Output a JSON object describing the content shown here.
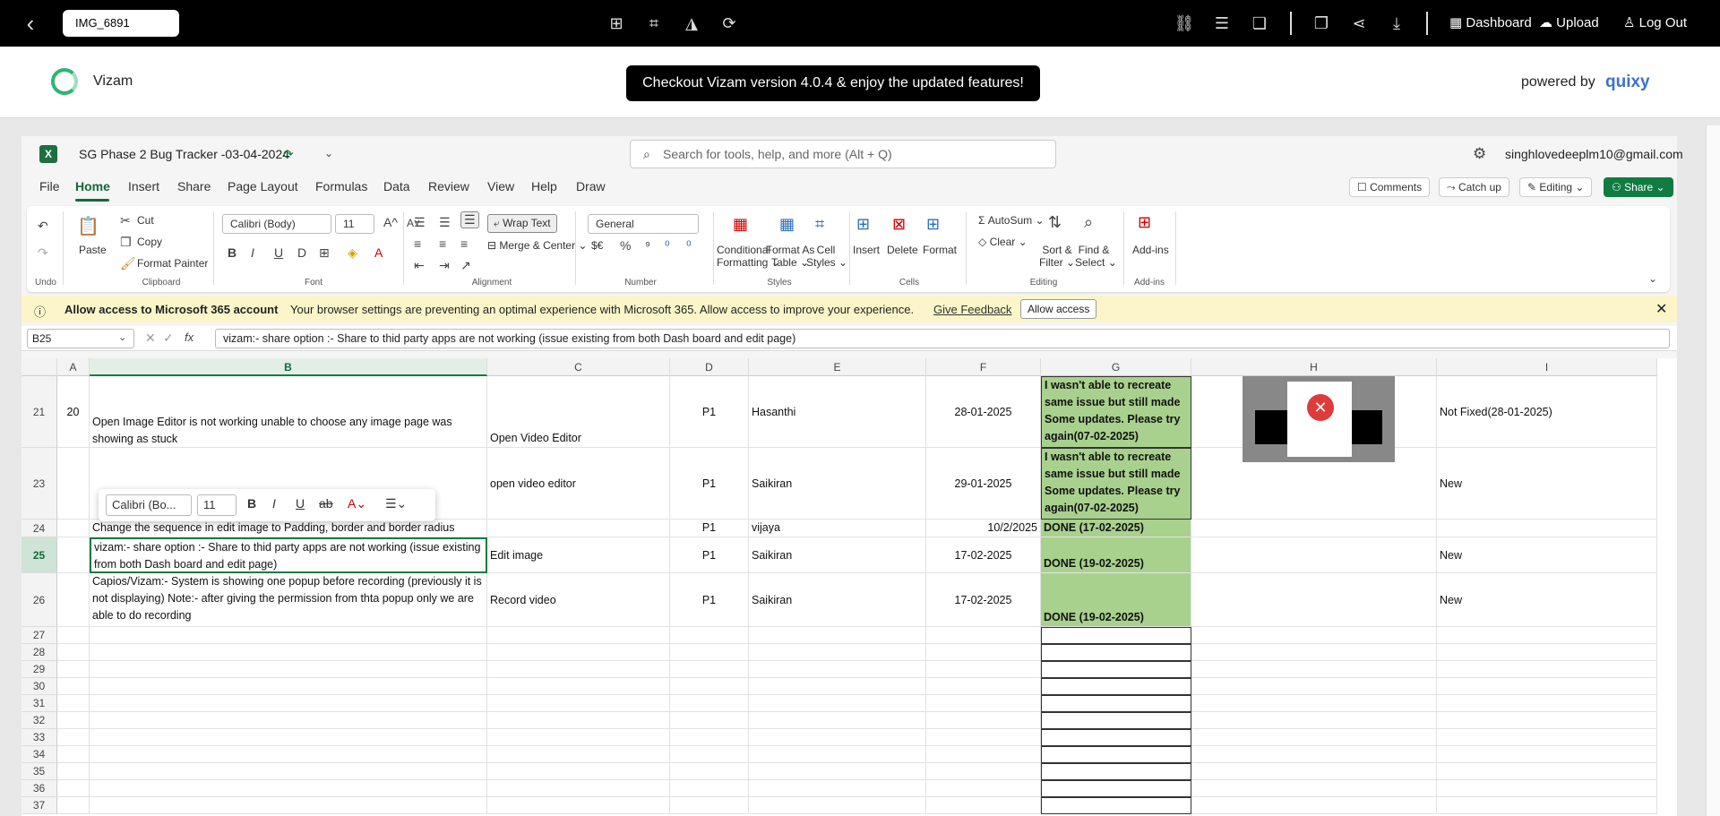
{
  "topbar": {
    "filename": "IMG_6891",
    "dashboard": "Dashboard",
    "upload": "Upload",
    "logout": "Log Out"
  },
  "header": {
    "brand": "Vizam",
    "promo": "Checkout Vizam version 4.0.4 & enjoy the updated features!",
    "powered_by": "powered by",
    "partner": "quixy"
  },
  "excel": {
    "doc_title": "SG Phase 2 Bug Tracker -03-04-2024",
    "search_placeholder": "Search for tools, help, and more (Alt + Q)",
    "account": "singhlovedeeplm10@gmail.com",
    "tabs": [
      "File",
      "Home",
      "Insert",
      "Share",
      "Page Layout",
      "Formulas",
      "Data",
      "Review",
      "View",
      "Help",
      "Draw"
    ],
    "top_buttons": {
      "comments": "Comments",
      "catchup": "Catch up",
      "editing": "Editing",
      "share": "Share"
    },
    "ribbon": {
      "undo_group": "Undo",
      "paste": "Paste",
      "cut": "Cut",
      "copy": "Copy",
      "format_painter": "Format Painter",
      "clipboard_group": "Clipboard",
      "font_name": "Calibri (Body)",
      "font_size": "11",
      "font_group": "Font",
      "wrap_text": "Wrap Text",
      "merge_center": "Merge & Center",
      "alignment_group": "Alignment",
      "number_format": "General",
      "currency": "$€",
      "number_group": "Number",
      "conditional": "Conditional",
      "formatting": "Formatting",
      "format_as": "Format As",
      "table": "Table",
      "cell": "Cell",
      "styles": "Styles",
      "styles_group": "Styles",
      "insert": "Insert",
      "delete": "Delete",
      "format": "Format",
      "cells_group": "Cells",
      "autosum": "AutoSum",
      "clear": "Clear",
      "sort": "Sort &",
      "filter": "Filter",
      "find": "Find &",
      "select": "Select",
      "editing_group": "Editing",
      "addins": "Add-ins",
      "addins_group": "Add-ins"
    },
    "infobar": {
      "title": "Allow access to Microsoft 365 account",
      "message": "Your browser settings are preventing an optimal experience with Microsoft 365. Allow access to improve your experience.",
      "feedback": "Give Feedback",
      "allow": "Allow access"
    },
    "namebox": "B25",
    "formula": "vizam:- share option :- Share to thid party apps are not working (issue existing from both Dash board and edit page)",
    "columns": [
      "A",
      "B",
      "C",
      "D",
      "E",
      "F",
      "G",
      "H",
      "I"
    ],
    "rows": {
      "r21": {
        "num": "21",
        "a": "20",
        "b": "Open Image Editor is not working unable to choose any image page was showing as stuck",
        "c": "Open Video Editor",
        "d": "P1",
        "e": "Hasanthi",
        "f": "28-01-2025",
        "g": "I wasn't able to recreate same issue but still made Some updates. Please try again(07-02-2025)",
        "i": "Not Fixed(28-01-2025)"
      },
      "r23": {
        "num": "23",
        "c": "open video editor",
        "d": "P1",
        "e": "Saikiran",
        "f": "29-01-2025",
        "g": "I wasn't able to recreate same issue but still made Some updates. Please try again(07-02-2025)",
        "i": "New"
      },
      "r24": {
        "num": "24",
        "b": "Change the sequence in edit image to Padding, border and border radius",
        "d": "P1",
        "e": "vijaya",
        "f": "10/2/2025",
        "g": "DONE (17-02-2025)"
      },
      "r25": {
        "num": "25",
        "b": "vizam:- share option :- Share to thid party apps are not working (issue existing from both Dash board and edit page)",
        "c": "Edit image",
        "d": "P1",
        "e": "Saikiran",
        "f": "17-02-2025",
        "g": "DONE (19-02-2025)",
        "i": "New"
      },
      "r26": {
        "num": "26",
        "b": "Capios/Vizam:- System is showing one popup before recording (previously it is not displaying) Note:- after giving the permission from thta popup only we are able to do recording",
        "c": "Record video",
        "d": "P1",
        "e": "Saikiran",
        "f": "17-02-2025",
        "g": "DONE (19-02-2025)",
        "i": "New"
      }
    },
    "empty_rows": [
      "27",
      "28",
      "29",
      "30",
      "31",
      "32",
      "33",
      "34",
      "35",
      "36",
      "37"
    ],
    "minitool": {
      "font": "Calibri (Bo...",
      "size": "11"
    }
  }
}
